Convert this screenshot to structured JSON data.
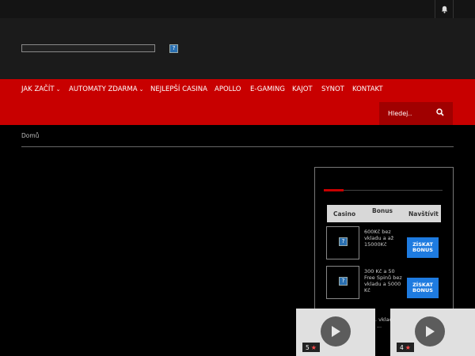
{
  "topbar": {
    "bell_icon": "bell-icon"
  },
  "header": {
    "logo_icon": "broken-image-icon"
  },
  "nav": {
    "items": [
      {
        "label": "JAK ZAČÍT",
        "has_dropdown": true
      },
      {
        "label": "AUTOMATY ZDARMA",
        "has_dropdown": true
      },
      {
        "label": "NEJLEPŠÍ CASINA",
        "has_dropdown": false
      },
      {
        "label": "APOLLO",
        "has_dropdown": false
      },
      {
        "label": "E-GAMING",
        "has_dropdown": false
      },
      {
        "label": "KAJOT",
        "has_dropdown": false
      },
      {
        "label": "SYNOT",
        "has_dropdown": false
      },
      {
        "label": "KONTAKT",
        "has_dropdown": false
      }
    ],
    "dropdown_glyph": "⌄",
    "search": {
      "placeholder": "Hledej..",
      "icon": "search-icon"
    }
  },
  "breadcrumb": {
    "home": "Domů"
  },
  "sidebar": {
    "table": {
      "headers": {
        "casino": "Casino",
        "bonus": "Bonus",
        "visit": "Navštívit"
      },
      "rows": [
        {
          "bonus_text": "600Kč bez vkladu a až 15000Kč",
          "button": "ZÍSKAT BONUS"
        },
        {
          "bonus_text": "300 Kč a 50 Free Spinů bez vkladu a 5000 Kč",
          "button": "ZÍSKAT BONUS"
        },
        {
          "bonus_text": "Kč ... vkladu ... Free ...",
          "button": ""
        }
      ]
    }
  },
  "videos": [
    {
      "rating": "5",
      "icon": "play-icon"
    },
    {
      "rating": "4",
      "icon": "play-icon"
    }
  ],
  "colors": {
    "nav_red": "#c80000",
    "button_blue": "#1e7be0",
    "header_bg": "#1b1b1b"
  }
}
